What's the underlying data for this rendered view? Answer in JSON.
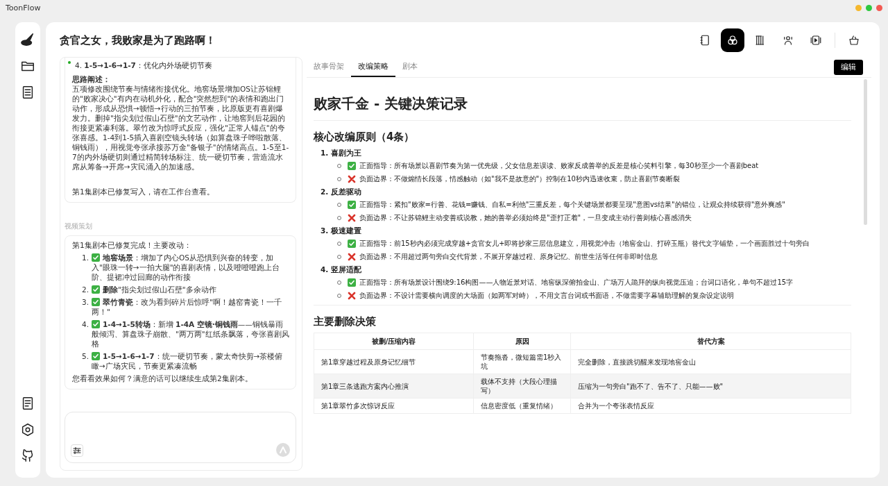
{
  "app": {
    "title": "ToonFlow"
  },
  "project": {
    "title": "贪官之女，我败家是为了跑路啊！"
  },
  "toolbar": {
    "items": [
      {
        "selected": false
      },
      {
        "selected": true
      },
      {
        "selected": false
      },
      {
        "selected": false
      },
      {
        "selected": false
      },
      {
        "selected": false
      }
    ]
  },
  "chat": {
    "messages": [
      {
        "heading_item": "4. **1-5→1-6→1-7**：优化内外场硬切节奏",
        "subheading": "思路阐述：",
        "paragraphs": [
          "五项修改围绕节奏与情绪衔接优化。地窖场景增加OS让苏锦鲤的\"败家决心\"有内在动机外化，配合\"突然想到\"的表情和跑出门动作，形成从恐惧→顿悟→行动的三拍节奏，比原版更有喜剧爆发力。删掉\"指尖划过假山石壁\"的文艺动作，让地窖到后花园的衔接更紧凑利落。翠竹改为惊呼式反应，强化\"正常人锚点\"的夸张喜感。1-4到1-5插入喜剧空镜头转场（如算盘珠子哗啦散落、铜钱雨），用视觉夸张承接苏万金\"备银子\"的情绪高点。1-5至1-7的内外场硬切则通过精简转场标注、统一硬切节奏，营造流水席从筹备→开席→灾民涌入的加速感。",
          "第1集剧本已修复写入，请在工作台查看。"
        ]
      },
      {
        "sender": "视频策划",
        "intro": "第1集剧本已修复完成！主要改动：",
        "items": [
          {
            "number": "1.",
            "kind": "check",
            "text": "**地窖场景**：增加了内心OS从恐惧到兴奋的转变，加入\"眼珠一转→一拍大腿\"的喜剧表情，以及噔噔噔跑上台阶、提裙冲过回廊的动作衔接"
          },
          {
            "number": "2.",
            "kind": "check",
            "text": "**删除**\"指尖划过假山石壁\"多余动作"
          },
          {
            "number": "3.",
            "kind": "check",
            "text": "**翠竹青瓷**：改为看到碎片后惊呼\"啊！越窑青瓷！一千两！\""
          },
          {
            "number": "4.",
            "kind": "check",
            "text": "**1-4→1-5转场**：新增 **1-4A 空镜·铜钱雨**——铜钱暴雨般倾泻、算盘珠子崩散、\"两万两\"红纸条飘落，夸张喜剧风格"
          },
          {
            "number": "5.",
            "kind": "check",
            "text": "**1-5→1-6→1-7**：统一硬切节奏，蒙太奇快剪→茶楼俯瞰→广场灾民，节奏更紧凑流畅"
          }
        ],
        "outro": "您看看效果如何？满意的话可以继续生成第2集剧本。"
      }
    ]
  },
  "tabs": [
    {
      "label": "故事骨架",
      "selected": false
    },
    {
      "label": "改编策略",
      "selected": true
    },
    {
      "label": "剧本",
      "selected": false
    }
  ],
  "edit_button": "编辑",
  "document": {
    "title": "败家千金 - 关键决策记录",
    "principles_heading": "核心改编原则（4条）",
    "principles": [
      {
        "number": "1.",
        "name": "喜剧为王",
        "points": [
          {
            "kind": "positive",
            "text": "正面指导：所有场景以喜剧节奏为第一优先级，父女信息差误读、败家反成善举的反差是核心笑料引擎，每30秒至少一个喜剧beat"
          },
          {
            "kind": "negative",
            "text": "负面边界：不做煽情长段落，情感触动（如\"我不是故意的\"）控制在10秒内迅速收束，防止喜剧节奏断裂"
          }
        ]
      },
      {
        "number": "2.",
        "name": "反差驱动",
        "points": [
          {
            "kind": "positive",
            "text": "正面指导：紧扣\"败家=行善、花钱=赚钱、自私=利他\"三重反差，每个关键场景都要呈现\"意图vs结果\"的错位，让观众持续获得\"意外爽感\""
          },
          {
            "kind": "negative",
            "text": "负面边界：不让苏锦鲤主动变善或说教，她的善举必须始终是\"歪打正着\"，一旦变成主动行善则核心喜感消失"
          }
        ]
      },
      {
        "number": "3.",
        "name": "极速建置",
        "points": [
          {
            "kind": "positive",
            "text": "正面指导：前15秒内必须完成穿越+贪官女儿+即将抄家三层信息建立，用视觉冲击（地窖金山、打碎玉瓶）替代文字铺垫，一个画面胜过十句旁白"
          },
          {
            "kind": "negative",
            "text": "负面边界：不用超过两句旁白交代背景，不展开穿越过程、原身记忆、前世生活等任何非即时信息"
          }
        ]
      },
      {
        "number": "4.",
        "name": "竖屏适配",
        "points": [
          {
            "kind": "positive",
            "text": "正面指导：所有场景设计围绕9:16构图——人物近景对话、地窖纵深俯拍金山、广场万人跪拜的纵向视觉压迫；台词口语化，单句不超过15字"
          },
          {
            "kind": "negative",
            "text": "负面边界：不设计需要横向调度的大场面（如两军对峙），不用文言台词或书面语，不做需要字幕辅助理解的复杂设定说明"
          }
        ]
      }
    ],
    "deletions_heading": "主要删除决策",
    "table": {
      "columns": [
        "被删/压缩内容",
        "原因",
        "替代方案"
      ],
      "rows": [
        [
          "第1章穿越过程及原身记忆细节",
          "节奏拖沓，微短篇需1秒入坑",
          "完全删除，直接跳切醒来发现地窖金山"
        ],
        [
          "第1章三条逃跑方案内心推演",
          "载体不支持（大段心理描写）",
          "压缩为一句旁白\"跑不了、告不了、只能——败\""
        ],
        [
          "第1章翠竹多次惊讶反应",
          "信息密度低（重复情绪）",
          "合并为一个夸张表情反应"
        ]
      ]
    }
  }
}
